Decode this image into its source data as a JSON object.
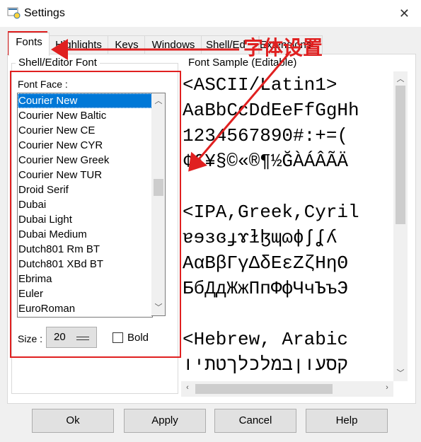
{
  "window": {
    "title": "Settings",
    "icon": "python-idle-icon"
  },
  "tabs": [
    {
      "label": "Fonts",
      "active": true
    },
    {
      "label": "Highlights"
    },
    {
      "label": "Keys"
    },
    {
      "label": "Windows"
    },
    {
      "label": "Shell/Ed"
    },
    {
      "label": "Extensions"
    }
  ],
  "font_group": {
    "legend": "Shell/Editor Font",
    "face_label": "Font Face :",
    "fonts": [
      "Courier New",
      "Courier New Baltic",
      "Courier New CE",
      "Courier New CYR",
      "Courier New Greek",
      "Courier New TUR",
      "Droid Serif",
      "Dubai",
      "Dubai Light",
      "Dubai Medium",
      "Dutch801 Rm BT",
      "Dutch801 XBd BT",
      "Ebrima",
      "Euler",
      "EuroRoman"
    ],
    "selected_font": "Courier New",
    "size_label": "Size :",
    "size_value": "20",
    "bold_label": "Bold",
    "bold_checked": false
  },
  "sample_group": {
    "legend": "Font Sample (Editable)",
    "lines": [
      "<ASCII/Latin1>",
      "AaBbCcDdEeFfGgHh",
      "1234567890#:+=(",
      "¢£¥§©«®¶½ĞÀÁÂÃÄ",
      "",
      "<IPA,Greek,Cyril",
      "ɐɘɜɞɟɤɫɮɰɷɸʃʆʎ",
      "ΑαΒβΓγΔδΕεΖζΗηΘ",
      "БбДдЖжПпФфЧчЪъЭ",
      "",
      "<Hebrew, Arabic",
      "קסעוןבמלכלךטתיו"
    ]
  },
  "buttons": {
    "ok": "Ok",
    "apply": "Apply",
    "cancel": "Cancel",
    "help": "Help"
  },
  "annotation": {
    "text": "字体设置",
    "color": "#e02020"
  },
  "colors": {
    "selection": "#0078d7",
    "annotation_red": "#e02020"
  }
}
